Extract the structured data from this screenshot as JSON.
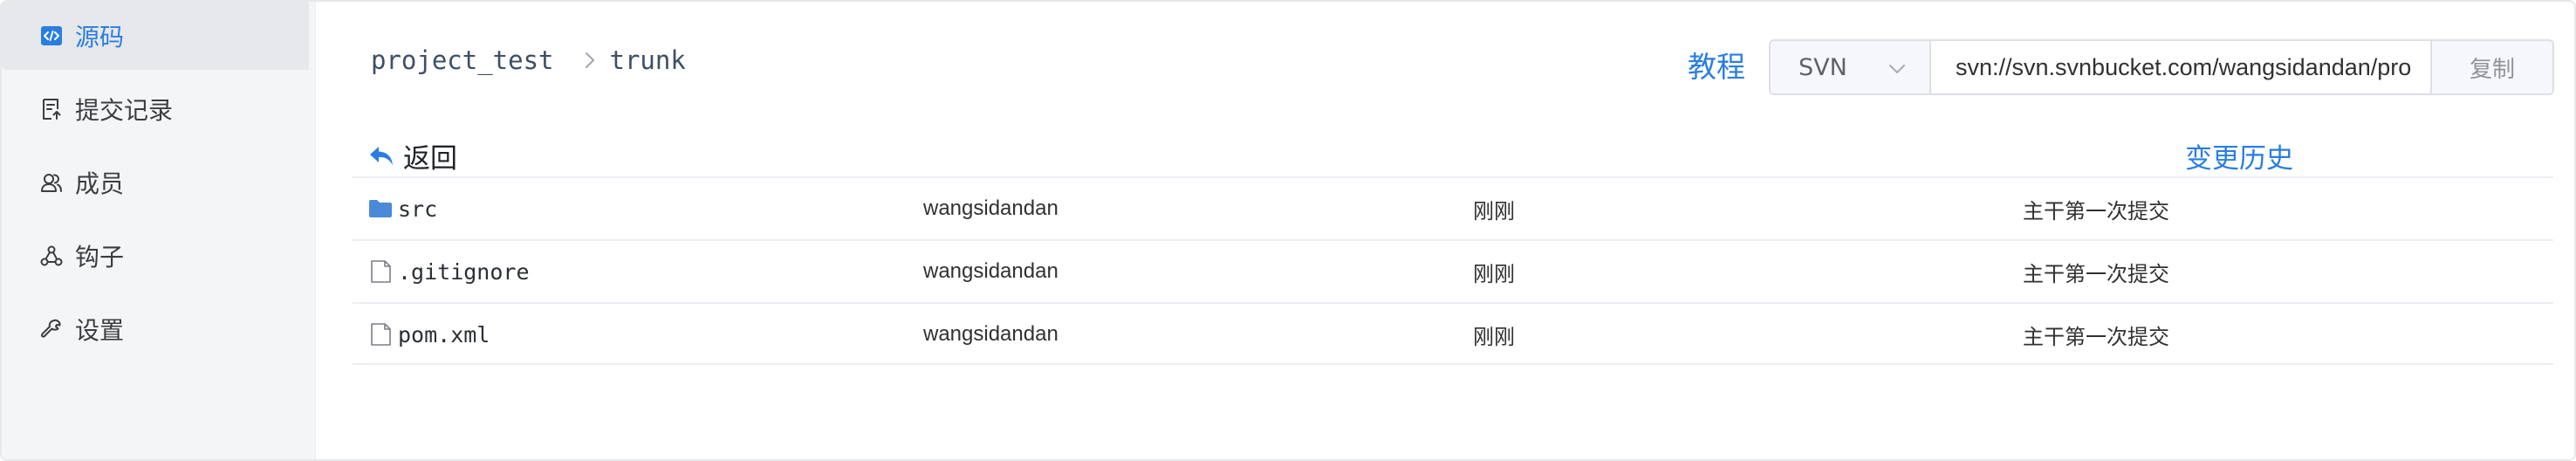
{
  "colors": {
    "accent": "#2a7ee0",
    "sidebar_bg": "#f4f5f7",
    "active_bg": "#e6e8eb",
    "folder": "#4a8ad8"
  },
  "sidebar": {
    "items": [
      {
        "label": "源码",
        "icon": "code-icon",
        "active": true
      },
      {
        "label": "提交记录",
        "icon": "commit-log-icon",
        "active": false
      },
      {
        "label": "成员",
        "icon": "members-icon",
        "active": false
      },
      {
        "label": "钩子",
        "icon": "webhook-icon",
        "active": false
      },
      {
        "label": "设置",
        "icon": "wrench-icon",
        "active": false
      }
    ]
  },
  "breadcrumb": {
    "project": "project_test",
    "branch": "trunk"
  },
  "header": {
    "tutorial_label": "教程",
    "vcs_type": "SVN",
    "repo_url": "svn://svn.svnbucket.com/wangsidandan/pro",
    "copy_label": "复制"
  },
  "actions": {
    "back_label": "返回",
    "history_label": "变更历史"
  },
  "files": [
    {
      "name": "src",
      "type": "folder",
      "author": "wangsidandan",
      "time": "刚刚",
      "message": "主干第一次提交"
    },
    {
      "name": ".gitignore",
      "type": "file",
      "author": "wangsidandan",
      "time": "刚刚",
      "message": "主干第一次提交"
    },
    {
      "name": "pom.xml",
      "type": "file",
      "author": "wangsidandan",
      "time": "刚刚",
      "message": "主干第一次提交"
    }
  ]
}
